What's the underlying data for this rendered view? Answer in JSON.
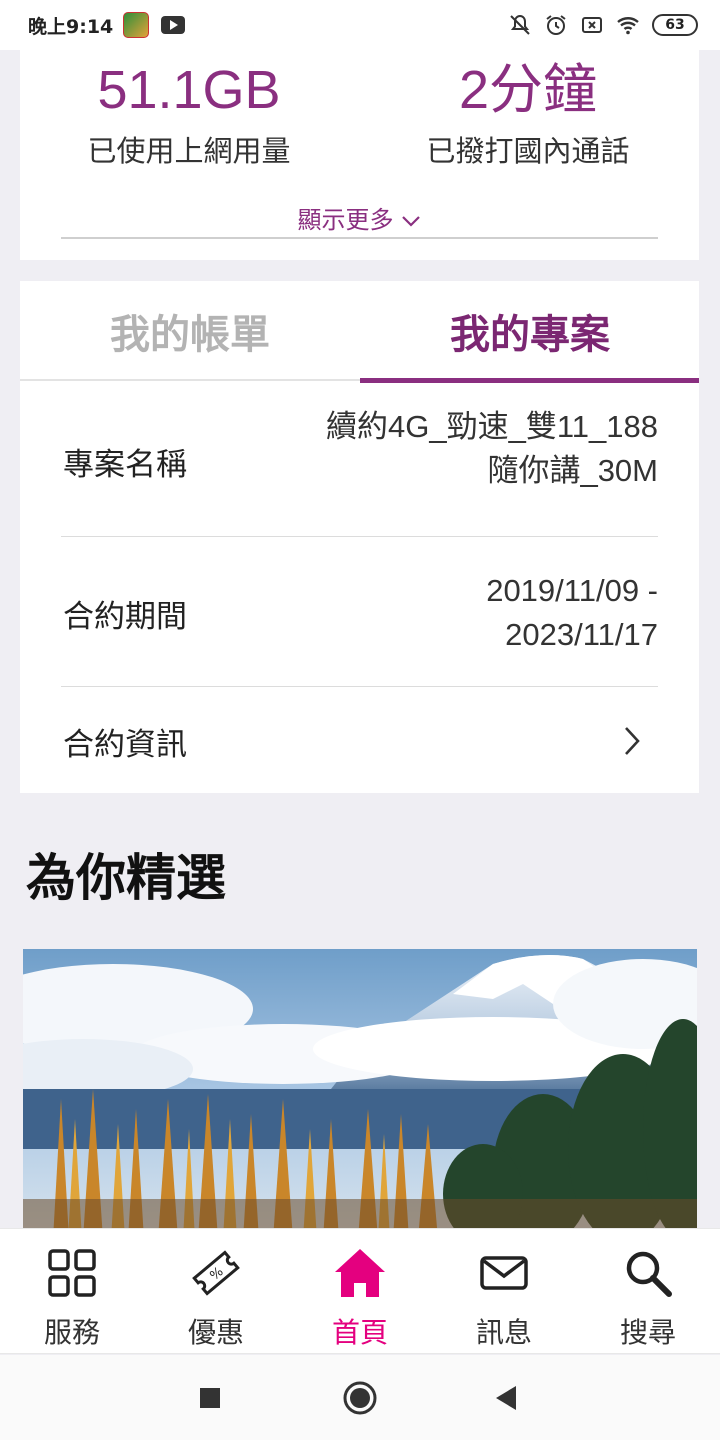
{
  "status_bar": {
    "time": "晚上9:14",
    "battery": "63"
  },
  "usage": {
    "data_used_value": "51.1GB",
    "data_used_label": "已使用上網用量",
    "calls_value": "2分鐘",
    "calls_label": "已撥打國內通話",
    "show_more": "顯示更多"
  },
  "tabs": {
    "bill": "我的帳單",
    "plan": "我的專案",
    "active": "plan"
  },
  "plan": {
    "name_label": "專案名稱",
    "name_value_line1": "續約4G_勁速_雙11_188",
    "name_value_line2": "隨你講_30M",
    "period_label": "合約期間",
    "period_value_line1": "2019/11/09 -",
    "period_value_line2": "2023/11/17",
    "contract_info_label": "合約資訊"
  },
  "featured": {
    "title": "為你精選"
  },
  "bottom_nav": {
    "items": [
      {
        "label": "服務",
        "icon": "grid-icon"
      },
      {
        "label": "優惠",
        "icon": "coupon-icon"
      },
      {
        "label": "首頁",
        "icon": "home-icon"
      },
      {
        "label": "訊息",
        "icon": "mail-icon"
      },
      {
        "label": "搜尋",
        "icon": "search-icon"
      }
    ],
    "active_index": 2
  },
  "colors": {
    "brand_purple": "#8a2f80",
    "active_pink": "#e4007f",
    "background": "#efeef3"
  }
}
